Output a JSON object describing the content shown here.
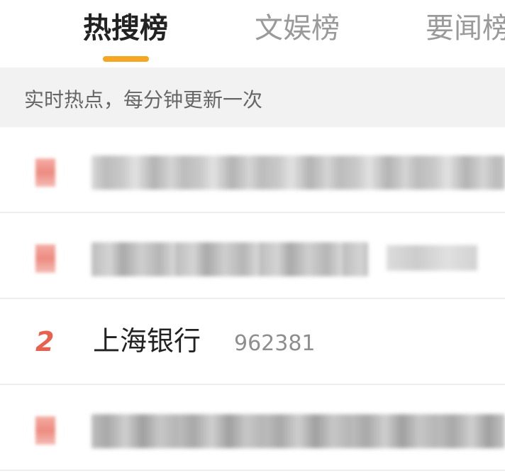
{
  "colors": {
    "accent": "#f5a623",
    "rank_red": "#e8614f",
    "active_tab": "#222222",
    "inactive_tab": "#9a9a9a"
  },
  "tabs": [
    {
      "label": "热搜榜",
      "active": true
    },
    {
      "label": "文娱榜",
      "active": false
    },
    {
      "label": "要闻榜",
      "active": false
    }
  ],
  "notice": {
    "text": "实时热点，每分钟更新一次"
  },
  "list": {
    "items": [
      {
        "rank": "",
        "title": "",
        "heat": "",
        "obscured": true
      },
      {
        "rank": "",
        "title": "",
        "heat": "",
        "obscured": true
      },
      {
        "rank": "2",
        "title": "上海银行",
        "heat": "962381",
        "obscured": false
      },
      {
        "rank": "",
        "title": "",
        "heat": "",
        "obscured": true
      }
    ]
  }
}
